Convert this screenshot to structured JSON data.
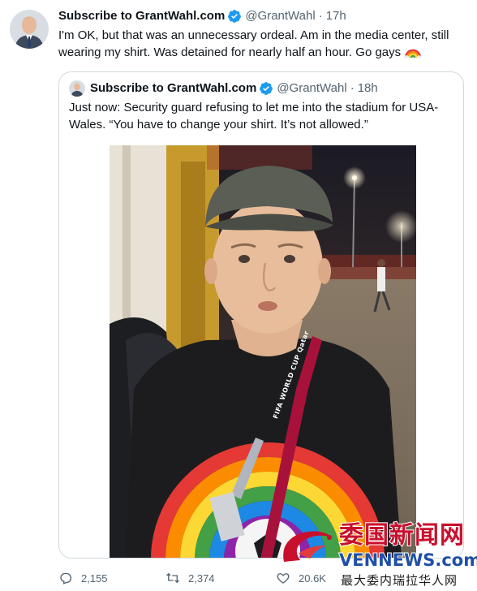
{
  "tweet": {
    "display_name": "Subscribe to GrantWahl.com",
    "handle": "@GrantWahl",
    "separator": "·",
    "time": "17h",
    "text": "I'm OK, but that was an unnecessary ordeal. Am in the media center, still wearing my shirt. Was detained for nearly half an hour. Go gays",
    "emoji": "rainbow-icon"
  },
  "quoted_tweet": {
    "display_name": "Subscribe to GrantWahl.com",
    "handle": "@GrantWahl",
    "separator": "·",
    "time": "18h",
    "text": "Just now: Security guard refusing to let me into the stadium for USA-Wales. “You have to change your shirt. It’s not allowed.”",
    "lanyard_text": "FIFA WORLD CUP Qatar"
  },
  "actions": {
    "reply_count": "2,155",
    "retweet_count": "2,374",
    "like_count": "20.6K"
  },
  "watermark": {
    "chinese_title": "委国新闻网",
    "site": "VENNEWS.com",
    "subtitle": "最大委内瑞拉华人网"
  },
  "colors": {
    "verified": "#1d9bf0",
    "secondary_text": "#536471",
    "border": "#cfd9de",
    "watermark_red": "#c8102e",
    "watermark_blue": "#1f4fa6"
  }
}
